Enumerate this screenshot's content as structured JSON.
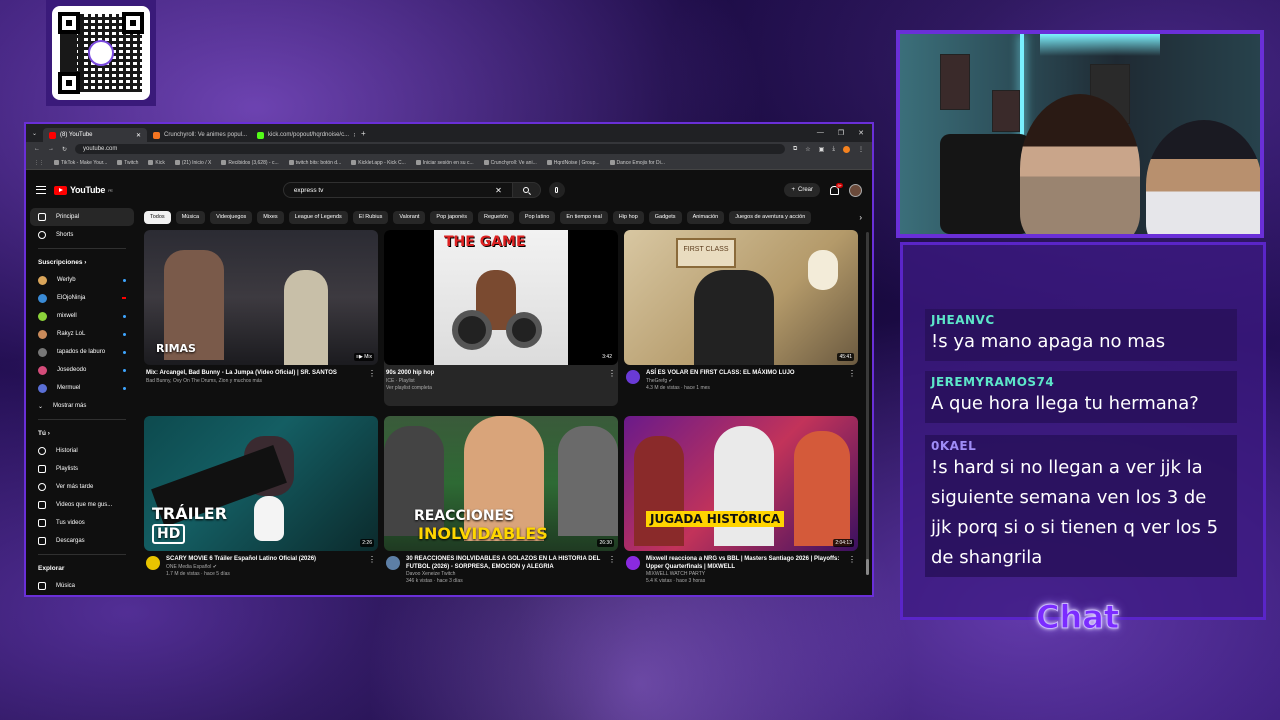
{
  "overlay": {
    "chat_label": "Chat"
  },
  "browser": {
    "tabs": [
      {
        "label": "(8) YouTube",
        "color": "#ff0000",
        "active": true
      },
      {
        "label": "Crunchyroll: Ve animes popul...",
        "color": "#f47521",
        "active": false
      },
      {
        "label": "kick.com/popout/hqrdnoise/c...",
        "color": "#53fc18",
        "active": false
      }
    ],
    "url": "youtube.com",
    "bookmarks": [
      "TikTok - Make Your...",
      "Twitch",
      "Kick",
      "(21) Inicio / X",
      "Recibidos (3,628) - c...",
      "twitch bits: botón d...",
      "Kicklet.app - Kick C...",
      "Iniciar sesión en su c...",
      "Crunchyroll: Ve ani...",
      "HqrdNoise | Group...",
      "Dance Emojis for Di..."
    ]
  },
  "youtube": {
    "logo": "YouTube",
    "logo_region": "PE",
    "search_query": "express tv",
    "create_label": "Crear",
    "notif_count": "9+",
    "sidebar": {
      "main": [
        {
          "label": "Principal",
          "active": true
        },
        {
          "label": "Shorts",
          "active": false
        }
      ],
      "subs_heading": "Suscripciones",
      "channels": [
        {
          "label": "Werlyb",
          "color": "#d9a55a",
          "indicator": "dot"
        },
        {
          "label": "ElOjoNinja",
          "color": "#3a8bd6",
          "indicator": "live"
        },
        {
          "label": "mixwell",
          "color": "#8bd23a",
          "indicator": "dot"
        },
        {
          "label": "Rakyz LoL",
          "color": "#c98a5a",
          "indicator": "dot"
        },
        {
          "label": "tapados de laburo",
          "color": "#777777",
          "indicator": "dot"
        },
        {
          "label": "Josedeodo",
          "color": "#d44c7a",
          "indicator": "dot"
        },
        {
          "label": "Mermuel",
          "color": "#5a6fd6",
          "indicator": "dot"
        }
      ],
      "show_more": "Mostrar más",
      "you_heading": "Tú",
      "you_items": [
        "Historial",
        "Playlists",
        "Ver más tarde",
        "Videos que me gus...",
        "Tus videos",
        "Descargas"
      ],
      "explore_heading": "Explorar",
      "explore_items": [
        "Música"
      ]
    },
    "chips": [
      "Todos",
      "Música",
      "Videojuegos",
      "Mixes",
      "League of Legends",
      "El Rubius",
      "Valorant",
      "Pop japonés",
      "Reguetón",
      "Pop latino",
      "En tiempo real",
      "Hip hop",
      "Gadgets",
      "Animación",
      "Juegos de aventura y acción"
    ],
    "videos": [
      {
        "title": "Mix: Arcangel, Bad Bunny - La Jumpa (Video Oficial) | SR. SANTOS",
        "line1": "Bad Bunny, Ovy On The Drums, Zion y muchos más",
        "line2": "",
        "line3": "",
        "duration": "Mix",
        "thumb_text": "RIMAS",
        "has_avatar": false
      },
      {
        "title": "90s 2000 hip hop",
        "line1": "ICE · Playlist",
        "line2": "Ver playlist completa",
        "line3": "",
        "duration": "3:42",
        "thumb_text": "THE GAME",
        "has_avatar": false
      },
      {
        "title": "ASÍ ES VOLAR EN FIRST CLASS: EL MÁXIMO LUJO",
        "line1": "TheGrefg",
        "line2": "4.3 M de vistas · hace 1 mes",
        "line3": "",
        "duration": "45:41",
        "thumb_text": "FIRST CLASS",
        "has_avatar": true
      },
      {
        "title": "SCARY MOVIE 6 Tráiler Español Latino Oficial (2026)",
        "line1": "ONE Media Español",
        "line2": "1.7 M de vistas · hace 5 días",
        "line3": "",
        "duration": "2:26",
        "thumb_text": "TRÁILER",
        "thumb_text2": "HD",
        "has_avatar": true
      },
      {
        "title": "30 REACCIONES INOLVIDABLES A GOLAZOS EN LA HISTORIA DEL FUTBOL (2026) - SORPRESA, EMOCION y ALEGRIA",
        "line1": "Davoo Xeneize Twitch",
        "line2": "346 k vistas · hace 3 días",
        "line3": "",
        "duration": "26:30",
        "thumb_text": "REACCIONES",
        "thumb_text2": "INOLVIDABLES",
        "has_avatar": true
      },
      {
        "title": "Mixwell reacciona a NRG vs BBL | Masters Santiago 2026 | Playoffs: Upper Quarterfinals | MIXWELL",
        "line1": "MIXWELL WATCH PARTY",
        "line2": "5.4 K vistas · hace 3 horas",
        "line3": "",
        "duration": "2:04:13",
        "thumb_text": "JUGADA HISTÓRICA",
        "has_avatar": true
      }
    ]
  },
  "chat": {
    "messages": [
      {
        "user": "JHEANVC",
        "text": "!s ya mano apaga no mas",
        "user_color": "green"
      },
      {
        "user": "JEREMYRAMOS74",
        "text": "A que hora llega tu hermana?",
        "user_color": "green"
      },
      {
        "user": "0KAEL",
        "text": "!s hard si no llegan a ver jjk la siguiente semana ven los 3 de jjk porq si o si tienen q ver los 5 de shangrila",
        "user_color": "purple"
      }
    ]
  }
}
